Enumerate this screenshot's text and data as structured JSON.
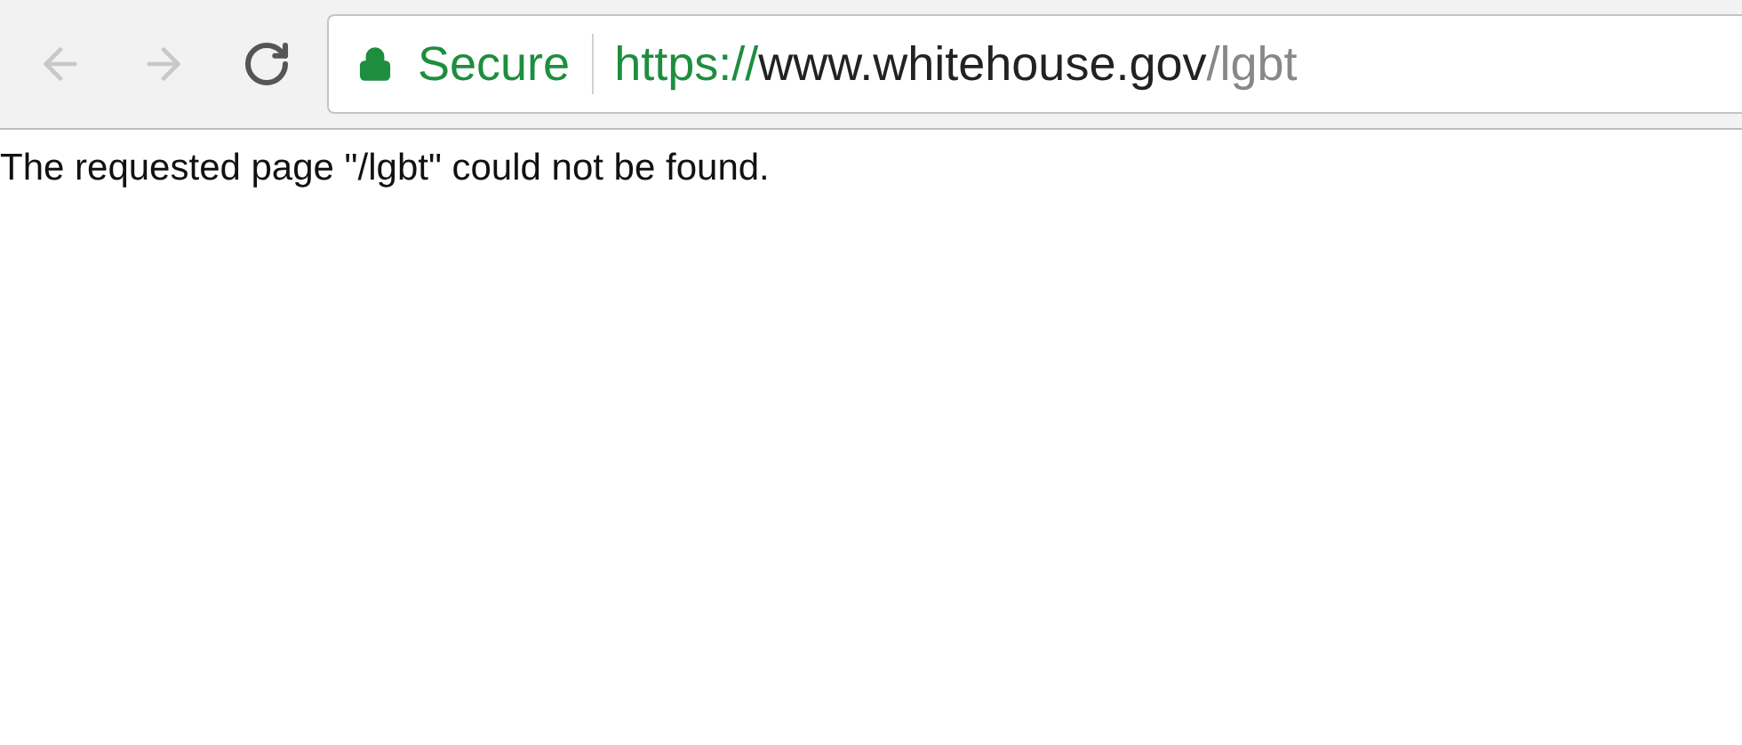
{
  "toolbar": {
    "back": {
      "disabled": true
    },
    "forward": {
      "disabled": true
    },
    "address_bar": {
      "security_label": "Secure",
      "scheme": "https://",
      "host": "www.whitehouse.gov",
      "path": "/lgbt"
    }
  },
  "page": {
    "message": "The requested page \"/lgbt\" could not be found."
  }
}
